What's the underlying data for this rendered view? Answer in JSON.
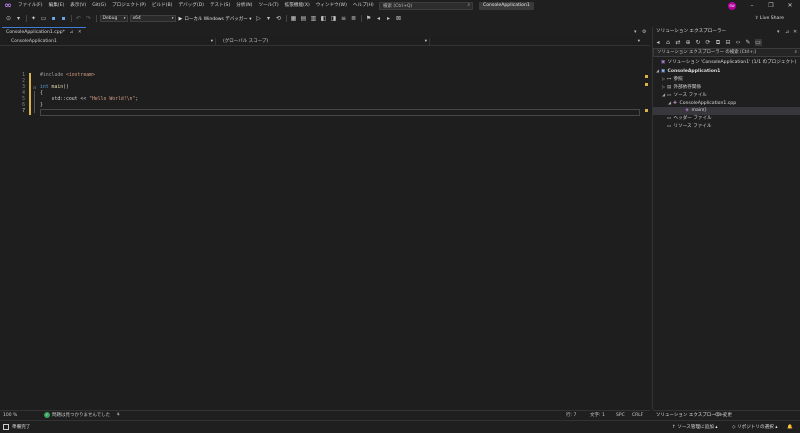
{
  "menu": {
    "items": [
      "ファイル(F)",
      "編集(E)",
      "表示(V)",
      "Git(G)",
      "プロジェクト(P)",
      "ビルド(B)",
      "デバッグ(D)",
      "テスト(S)",
      "分析(N)",
      "ツール(T)",
      "拡張機能(X)",
      "ウィンドウ(W)",
      "ヘルプ(H)"
    ],
    "search_placeholder": "検索 (Ctrl+Q)",
    "solution_name": "ConsoleApplication1",
    "user_initials": "SW"
  },
  "toolbar": {
    "configuration": "Debug",
    "platform": "x64",
    "run_label": "ローカル Windows デバッガー",
    "live_share": "Live Share"
  },
  "editor": {
    "tab_title": "ConsoleApplication1.cpp*",
    "nav_project": "ConsoleApplication1",
    "nav_scope": "(グローバル スコープ)",
    "line_numbers": [
      "1",
      "2",
      "3",
      "4",
      "5",
      "6",
      "7"
    ],
    "code": {
      "line1_directive": "#include",
      "line1_header": " <iostream>",
      "line3_type": "int",
      "line3_name": " main",
      "line3_rest": "()",
      "line4": "{",
      "line5_pre": "    std::cout << ",
      "line5_str": "\"Hello World!\\n\"",
      "line5_post": ";",
      "line6": "}"
    },
    "status": {
      "zoom": "100 %",
      "issues": "問題は見つかりませんでした",
      "line": "行: 7",
      "col": "文字: 1",
      "spc": "SPC",
      "eol": "CRLF"
    }
  },
  "solution_explorer": {
    "title": "ソリューション エクスプローラー",
    "search_placeholder": "ソリューション エクスプローラー の検索 (Ctrl+;)",
    "tree": [
      {
        "label": "ソリューション 'ConsoleApplication1' (1/1 のプロジェクト)",
        "icon": "solution-icon",
        "depth": 0
      },
      {
        "label": "ConsoleApplication1",
        "icon": "project-icon",
        "depth": 1
      },
      {
        "label": "参照",
        "icon": "references-icon",
        "depth": 2
      },
      {
        "label": "外部依存関係",
        "icon": "external-deps-icon",
        "depth": 2
      },
      {
        "label": "ソース ファイル",
        "icon": "folder-icon",
        "depth": 2
      },
      {
        "label": "ConsoleApplication1.cpp",
        "icon": "cpp-file-icon",
        "depth": 3
      },
      {
        "label": "main()",
        "icon": "function-icon",
        "depth": 4
      },
      {
        "label": "ヘッダー ファイル",
        "icon": "folder-icon",
        "depth": 2
      },
      {
        "label": "リソース ファイル",
        "icon": "folder-icon",
        "depth": 2
      }
    ],
    "tabs": [
      "ソリューション エクスプローラー",
      "Git 変更"
    ]
  },
  "statusbar": {
    "ready": "準備完了",
    "source_control": "ソース管理に追加",
    "repo": "リポジトリの選択"
  },
  "colors": {
    "accent": "#3d7bd6",
    "keyword": "#569cd6",
    "string": "#d69d85",
    "change_marker": "#d7b34a"
  }
}
